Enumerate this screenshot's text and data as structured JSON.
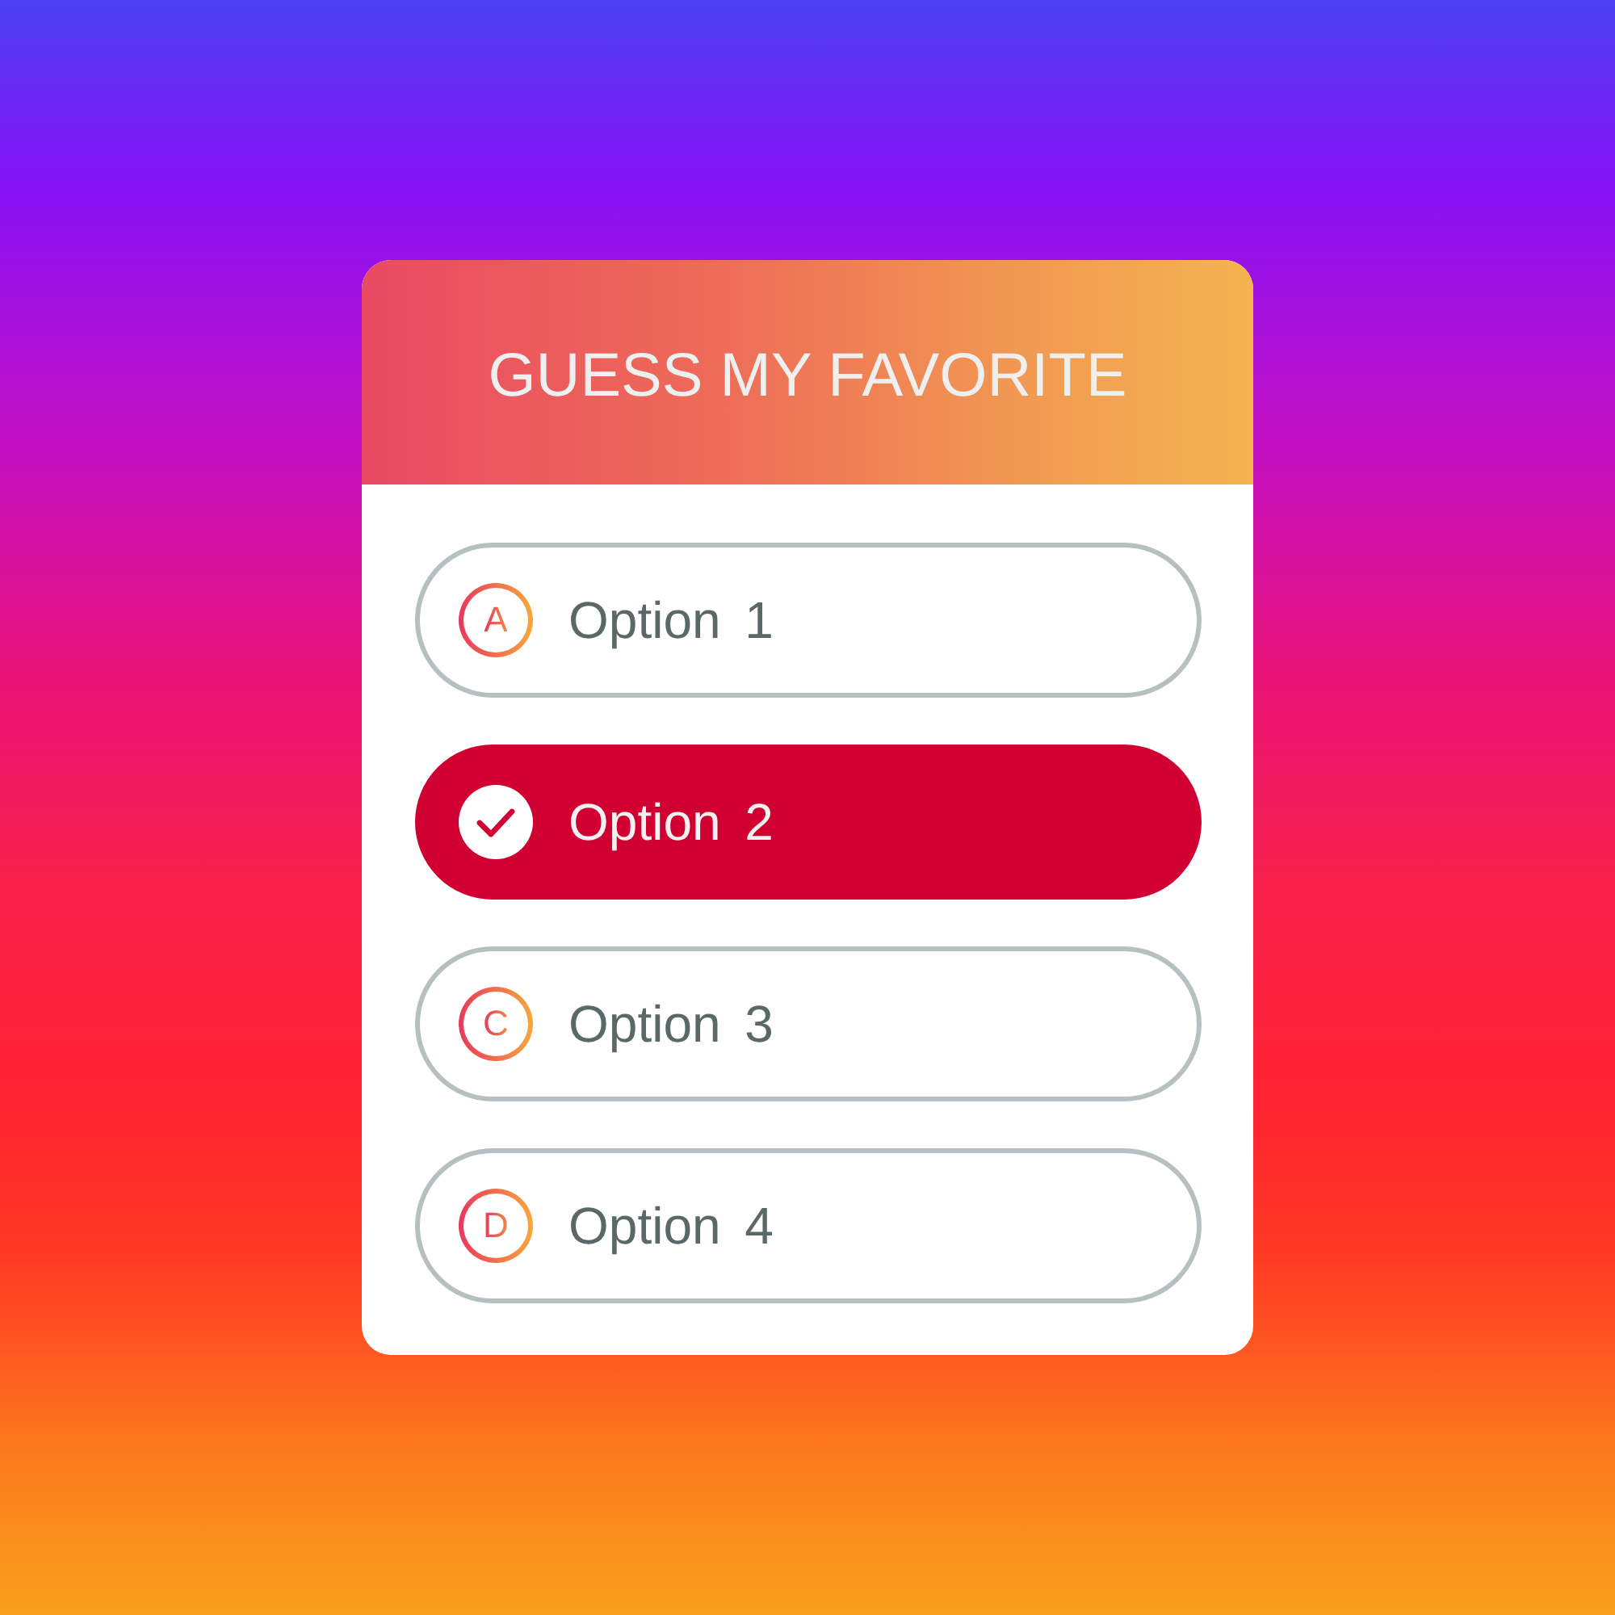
{
  "title": "GUESS MY FAVORITE",
  "options": [
    {
      "letter": "A",
      "label": "Option 1",
      "selected": false
    },
    {
      "label": "Option 2",
      "selected": true
    },
    {
      "letter": "C",
      "label": "Option 3",
      "selected": false
    },
    {
      "letter": "D",
      "label": "Option 4",
      "selected": false
    }
  ]
}
